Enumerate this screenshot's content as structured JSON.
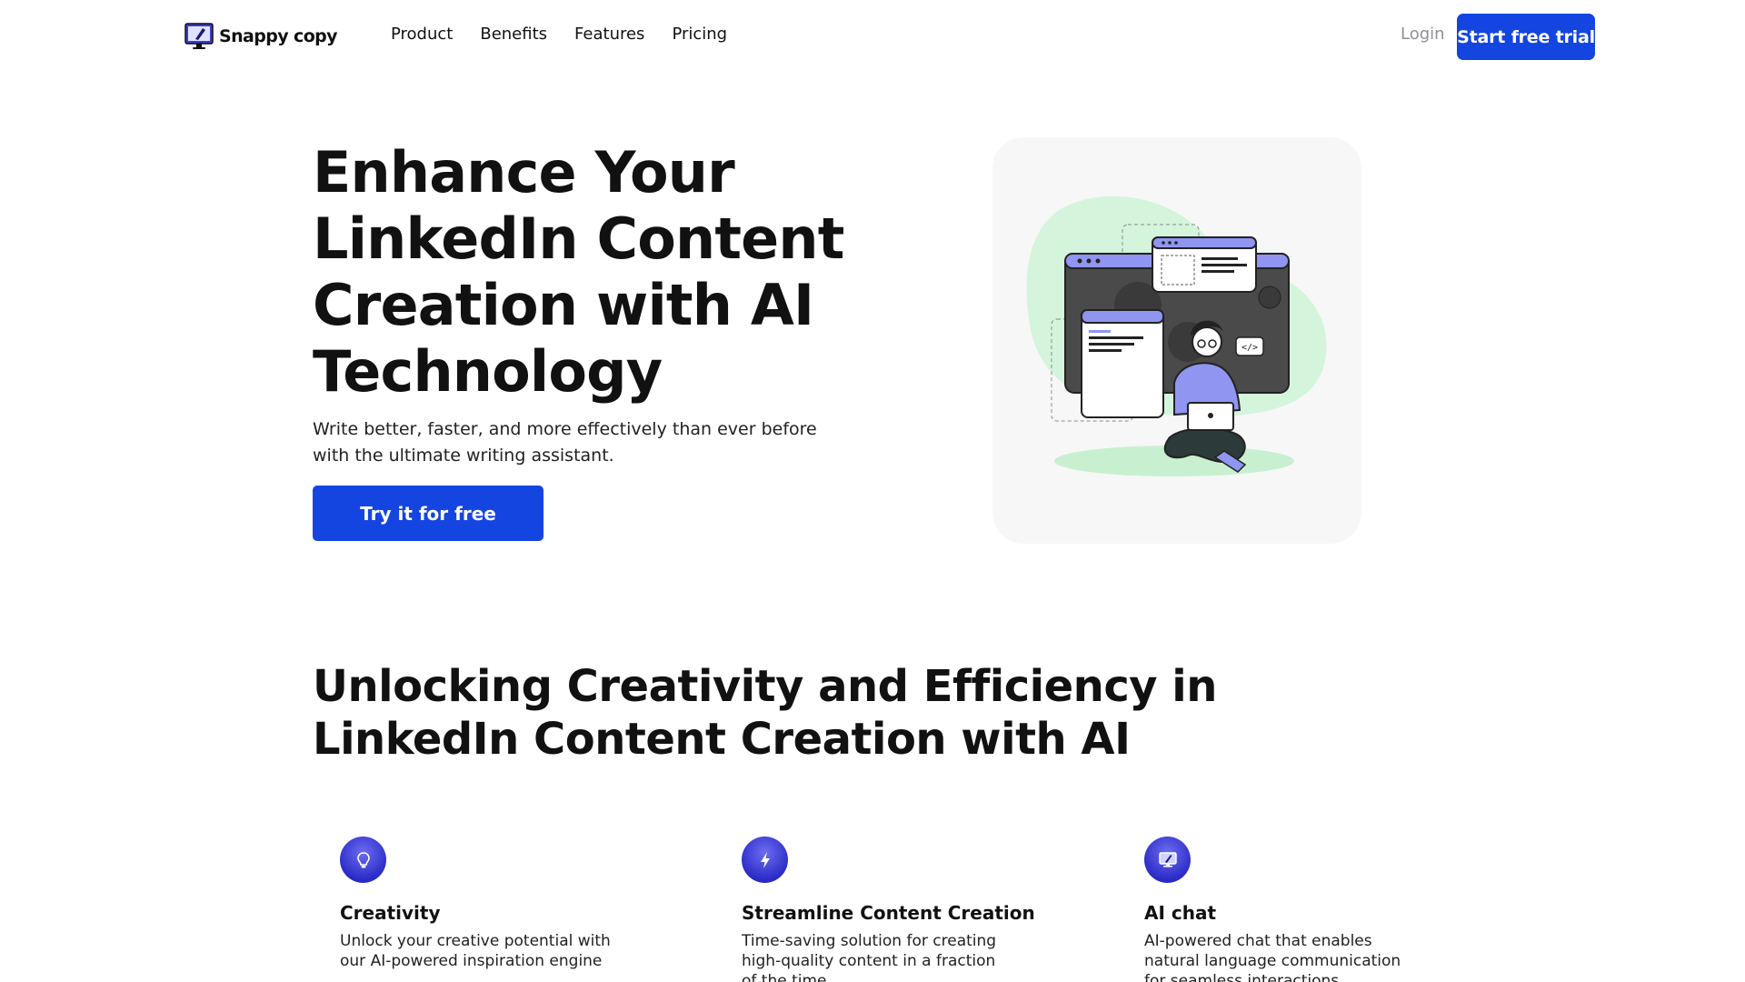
{
  "brand": {
    "name": "Snappy copy",
    "accent": "#1545e0"
  },
  "nav": {
    "items": [
      {
        "label": "Product"
      },
      {
        "label": "Benefits"
      },
      {
        "label": "Features"
      },
      {
        "label": "Pricing"
      }
    ],
    "login_label": "Login",
    "trial_label": "Start free trial"
  },
  "hero": {
    "title": "Enhance Your LinkedIn Content Creation with AI Technology",
    "subtitle": "Write better, faster, and more effectively than ever before with the ultimate writing assistant.",
    "cta_label": "Try it for free",
    "illustration": "person-with-laptop-and-code-windows"
  },
  "section": {
    "title": "Unlocking Creativity and Efficiency in LinkedIn Content Creation with AI"
  },
  "features": [
    {
      "icon": "lightbulb-icon",
      "title": "Creativity",
      "desc": "Unlock your creative potential with our AI-powered inspiration engine"
    },
    {
      "icon": "lightning-icon",
      "title": "Streamline Content Creation",
      "desc": "Time-saving solution for creating high-quality content in a fraction of the time"
    },
    {
      "icon": "monitor-chat-icon",
      "title": "AI chat",
      "desc": "AI-powered chat that enables natural language communication for seamless interactions"
    }
  ]
}
